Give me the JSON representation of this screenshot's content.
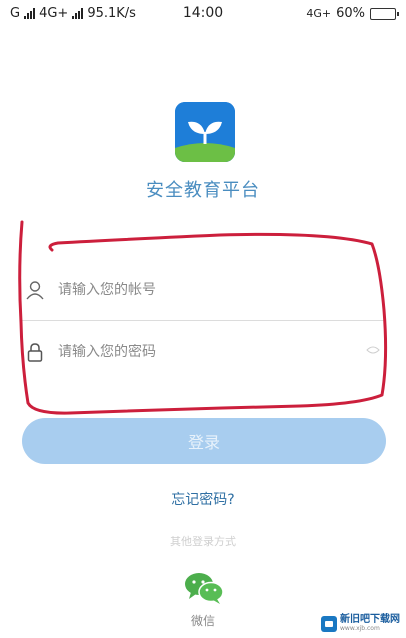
{
  "status_bar": {
    "carrier_left": "G",
    "network_label": "4G+",
    "speed": "95.1K/s",
    "time": "14:00",
    "network_right": "4G+",
    "battery_percent": "60%",
    "battery_level": 0.6
  },
  "app": {
    "title": "安全教育平台",
    "logo_icon": "sprout-logo-icon",
    "colors": {
      "logo_blue": "#1e7ed8",
      "logo_green": "#6cbf45",
      "accent_text": "#4a8dc0"
    }
  },
  "login": {
    "username_placeholder": "请输入您的帐号",
    "password_placeholder": "请输入您的密码",
    "login_button_label": "登录",
    "forgot_password": "忘记密码?",
    "other_login_methods": "其他登录方式",
    "wechat_label": "微信"
  },
  "watermark": {
    "text": "新旧吧下载网",
    "url": "www.xjb.com"
  }
}
